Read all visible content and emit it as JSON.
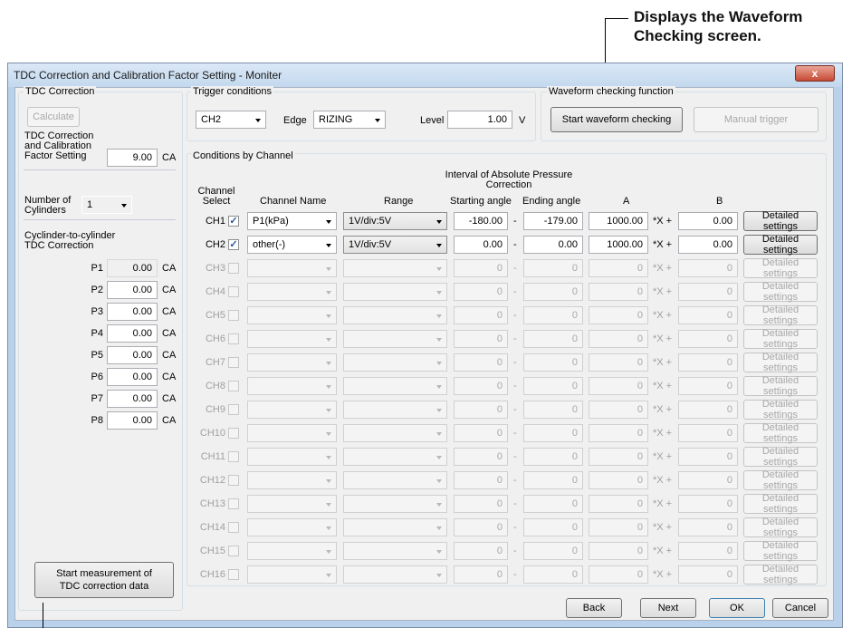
{
  "callout_top": [
    "Displays the Waveform",
    "Checking screen."
  ],
  "window": {
    "title": "TDC Correction and Calibration Factor Setting - Moniter",
    "close_glyph": "x"
  },
  "tdc": {
    "group_title": "TDC Correction",
    "calculate": "Calculate",
    "calfactor_label": "TDC Correction and Calibration Factor Setting",
    "calfactor_value": "9.00",
    "ca": "CA",
    "cyl_label": "Number of Cylinders",
    "cyl_value": "1",
    "c2c_label": "Cyclinder-to-cylinder TDC Correction",
    "p_labels": [
      "P1",
      "P2",
      "P3",
      "P4",
      "P5",
      "P6",
      "P7",
      "P8"
    ],
    "p_values": [
      "0.00",
      "0.00",
      "0.00",
      "0.00",
      "0.00",
      "0.00",
      "0.00",
      "0.00"
    ],
    "start_measure": "Start measurement of TDC correction data"
  },
  "trigger": {
    "group_title": "Trigger conditions",
    "source": "CH2",
    "edge_label": "Edge",
    "edge": "RIZING",
    "level_label": "Level",
    "level": "1.00",
    "unit": "V"
  },
  "wave": {
    "group_title": "Waveform checking function",
    "start": "Start waveform checking",
    "manual": "Manual trigger"
  },
  "cond": {
    "group_title": "Conditions by Channel",
    "h_channel_select": "Channel Select",
    "h_channel_name": "Channel Name",
    "h_range": "Range",
    "h_interval": "Interval of Absolute Pressure Correction",
    "h_start": "Starting angle",
    "h_end": "Ending angle",
    "h_a": "A",
    "h_b": "B",
    "dash": "-",
    "mult": "*X +",
    "detail": "Detailed settings",
    "rows": [
      {
        "ch": "CH1",
        "checked": true,
        "name": "P1(kPa)",
        "range": "1V/div:5V",
        "start": "-180.00",
        "end": "-179.00",
        "a": "1000.00",
        "b": "0.00",
        "enabled": true
      },
      {
        "ch": "CH2",
        "checked": true,
        "name": "other(-)",
        "range": "1V/div:5V",
        "start": "0.00",
        "end": "0.00",
        "a": "1000.00",
        "b": "0.00",
        "enabled": true
      },
      {
        "ch": "CH3",
        "checked": false,
        "name": "",
        "range": "",
        "start": "0",
        "end": "0",
        "a": "0",
        "b": "0",
        "enabled": false
      },
      {
        "ch": "CH4",
        "checked": false,
        "name": "",
        "range": "",
        "start": "0",
        "end": "0",
        "a": "0",
        "b": "0",
        "enabled": false
      },
      {
        "ch": "CH5",
        "checked": false,
        "name": "",
        "range": "",
        "start": "0",
        "end": "0",
        "a": "0",
        "b": "0",
        "enabled": false
      },
      {
        "ch": "CH6",
        "checked": false,
        "name": "",
        "range": "",
        "start": "0",
        "end": "0",
        "a": "0",
        "b": "0",
        "enabled": false
      },
      {
        "ch": "CH7",
        "checked": false,
        "name": "",
        "range": "",
        "start": "0",
        "end": "0",
        "a": "0",
        "b": "0",
        "enabled": false
      },
      {
        "ch": "CH8",
        "checked": false,
        "name": "",
        "range": "",
        "start": "0",
        "end": "0",
        "a": "0",
        "b": "0",
        "enabled": false
      },
      {
        "ch": "CH9",
        "checked": false,
        "name": "",
        "range": "",
        "start": "0",
        "end": "0",
        "a": "0",
        "b": "0",
        "enabled": false
      },
      {
        "ch": "CH10",
        "checked": false,
        "name": "",
        "range": "",
        "start": "0",
        "end": "0",
        "a": "0",
        "b": "0",
        "enabled": false
      },
      {
        "ch": "CH11",
        "checked": false,
        "name": "",
        "range": "",
        "start": "0",
        "end": "0",
        "a": "0",
        "b": "0",
        "enabled": false
      },
      {
        "ch": "CH12",
        "checked": false,
        "name": "",
        "range": "",
        "start": "0",
        "end": "0",
        "a": "0",
        "b": "0",
        "enabled": false
      },
      {
        "ch": "CH13",
        "checked": false,
        "name": "",
        "range": "",
        "start": "0",
        "end": "0",
        "a": "0",
        "b": "0",
        "enabled": false
      },
      {
        "ch": "CH14",
        "checked": false,
        "name": "",
        "range": "",
        "start": "0",
        "end": "0",
        "a": "0",
        "b": "0",
        "enabled": false
      },
      {
        "ch": "CH15",
        "checked": false,
        "name": "",
        "range": "",
        "start": "0",
        "end": "0",
        "a": "0",
        "b": "0",
        "enabled": false
      },
      {
        "ch": "CH16",
        "checked": false,
        "name": "",
        "range": "",
        "start": "0",
        "end": "0",
        "a": "0",
        "b": "0",
        "enabled": false
      }
    ]
  },
  "footer": {
    "back": "Back",
    "next": "Next",
    "ok": "OK",
    "cancel": "Cancel"
  }
}
